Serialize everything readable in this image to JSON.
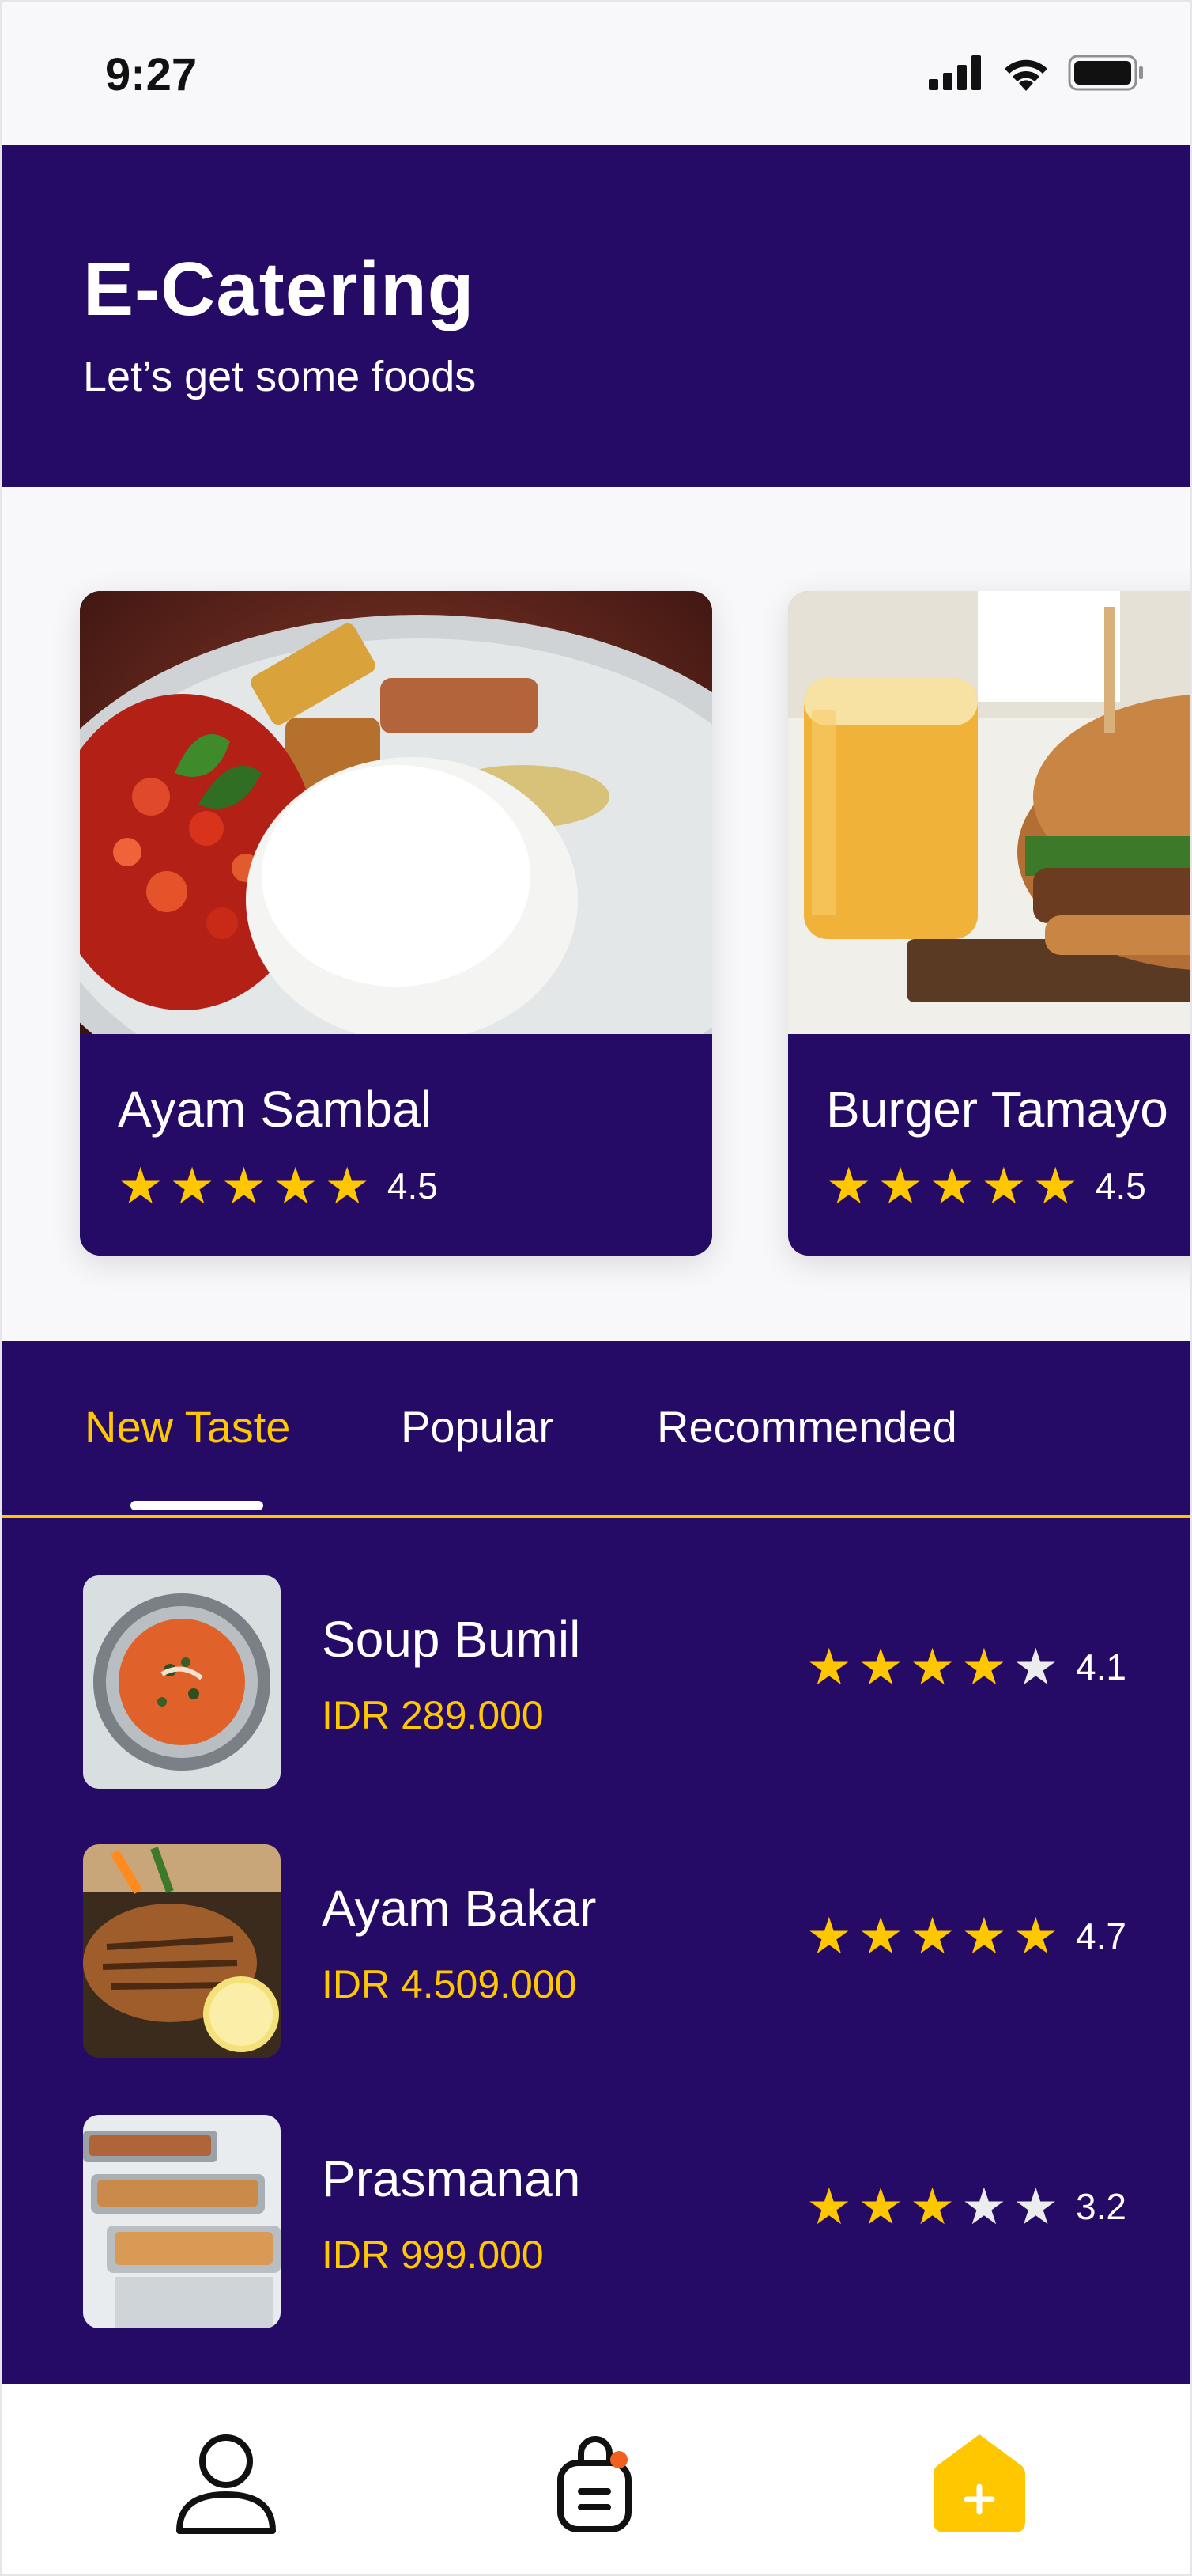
{
  "status_bar": {
    "time": "9:27",
    "icons": [
      "signal-icon",
      "wifi-icon",
      "battery-icon"
    ]
  },
  "header": {
    "title": "E-Catering",
    "subtitle": "Let’s get some foods"
  },
  "featured": [
    {
      "name": "Ayam Sambal",
      "rating": 4.5,
      "rating_label": "4.5"
    },
    {
      "name": "Burger Tamayo",
      "rating": 4.5,
      "rating_label": "4.5"
    }
  ],
  "tabs": [
    {
      "label": "New Taste",
      "active": true
    },
    {
      "label": "Popular",
      "active": false
    },
    {
      "label": "Recommended",
      "active": false
    }
  ],
  "food_list": [
    {
      "name": "Soup Bumil",
      "price": "IDR 289.000",
      "rating": 4.1,
      "rating_label": "4.1"
    },
    {
      "name": "Ayam Bakar",
      "price": "IDR 4.509.000",
      "rating": 4.7,
      "rating_label": "4.7"
    },
    {
      "name": "Prasmanan",
      "price": "IDR 999.000",
      "rating": 3.2,
      "rating_label": "3.2"
    }
  ],
  "bottom_nav": {
    "items": [
      "profile-icon",
      "shopping-bag-icon",
      "add-home-icon"
    ]
  },
  "colors": {
    "primary": "#250A66",
    "accent": "#FFC700",
    "background": "#F8F8FA",
    "star_off": "#ECECEC"
  }
}
